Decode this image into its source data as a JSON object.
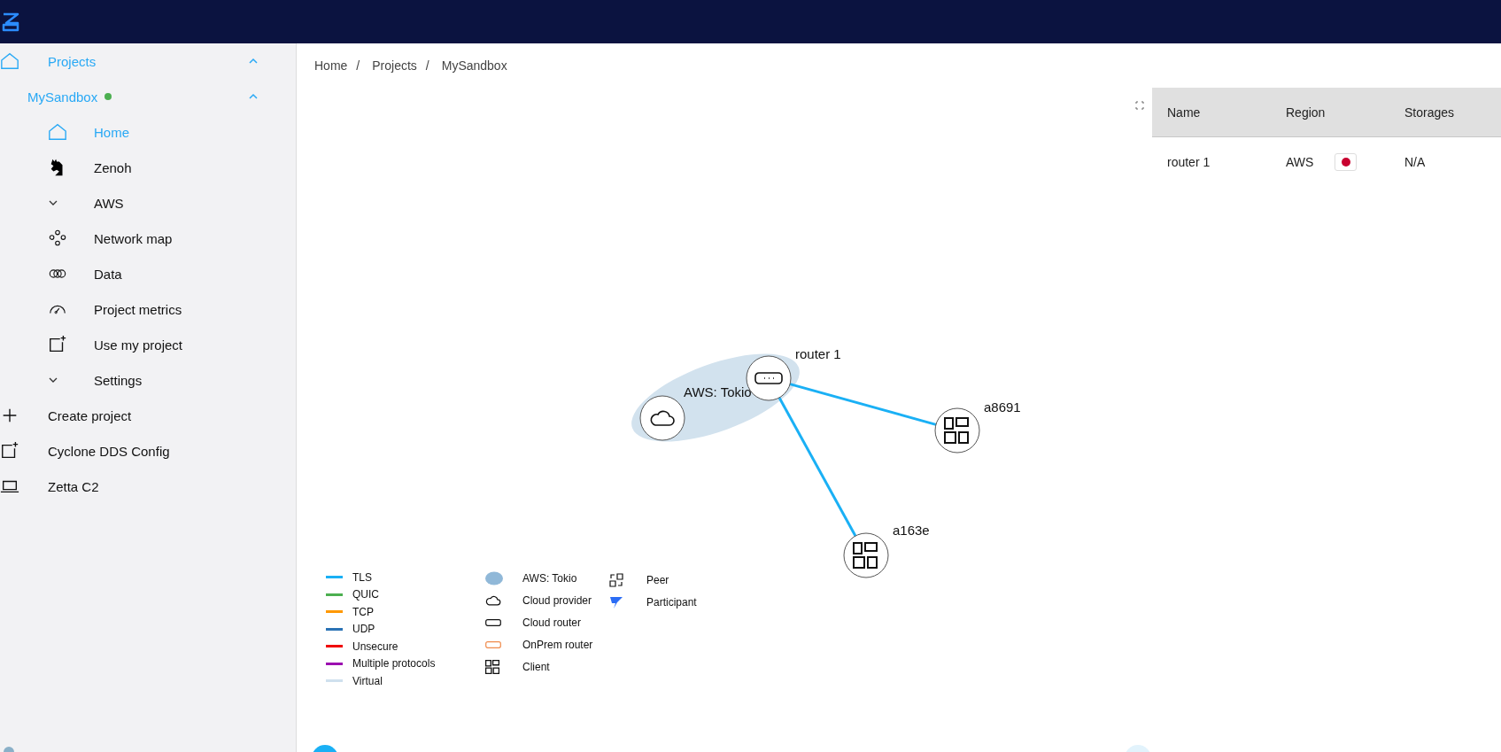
{
  "sidebar": {
    "items": [
      {
        "label": "Projects",
        "kind": "home",
        "selected": true,
        "expanded": true,
        "children": [
          {
            "label": "MySandbox",
            "color": "#4caf50",
            "selected": true,
            "expanded": true,
            "children": [
              {
                "label": "Home",
                "kind": "home",
                "selected": true
              },
              {
                "label": "Zenoh",
                "kind": "dragon",
                "selected": false
              },
              {
                "label": "AWS",
                "kind": "chevron",
                "selected": false
              },
              {
                "label": "Network map",
                "kind": "nodes",
                "selected": false
              },
              {
                "label": "Data",
                "kind": "rings",
                "selected": false
              },
              {
                "label": "Project metrics",
                "kind": "gauge",
                "selected": false
              },
              {
                "label": "Use my project",
                "kind": "addbox",
                "selected": false
              },
              {
                "label": "Settings",
                "kind": "chevron",
                "selected": false
              }
            ]
          }
        ]
      },
      {
        "label": "Create project",
        "kind": "plus",
        "selected": false
      },
      {
        "label": "Cyclone DDS Config",
        "kind": "addbox",
        "selected": false
      },
      {
        "label": "Zetta C2",
        "kind": "laptop",
        "selected": false
      }
    ]
  },
  "breadcrumbs": [
    {
      "label": "Home",
      "separator": "/"
    },
    {
      "label": "Projects",
      "separator": "/"
    },
    {
      "label": "MySandbox"
    }
  ],
  "graph": {
    "region": {
      "label": "AWS: Tokio"
    },
    "nodes": [
      {
        "kind": "cloud"
      },
      {
        "label": "router 1",
        "kind": "router"
      },
      {
        "label": "a8691",
        "kind": "client"
      },
      {
        "label": "a163e",
        "kind": "client"
      }
    ],
    "edges": [
      {
        "color": "#1ab0f5"
      },
      {
        "color": "#1ab0f5"
      }
    ]
  },
  "legend": {
    "protocols": [
      {
        "label": "TLS",
        "color": "#1ab0f5"
      },
      {
        "label": "QUIC",
        "color": "#4caf50"
      },
      {
        "label": "TCP",
        "color": "#ff9800"
      },
      {
        "label": "UDP",
        "color": "#2a72b5"
      },
      {
        "label": "Unsecure",
        "color": "#f00000"
      },
      {
        "label": "Multiple protocols",
        "color": "#9c0fb0"
      },
      {
        "label": "Virtual",
        "color": "#cfe0ee"
      }
    ],
    "symbols": [
      {
        "label": "AWS: Tokio",
        "kind": "region"
      },
      {
        "label": "Cloud provider",
        "kind": "cloud"
      },
      {
        "label": "Cloud router",
        "kind": "router"
      },
      {
        "label": "OnPrem router",
        "kind": "onprem"
      },
      {
        "label": "Client",
        "kind": "client"
      }
    ],
    "roles": [
      {
        "label": "Peer",
        "kind": "peer"
      },
      {
        "label": "Participant",
        "kind": "participant"
      }
    ]
  },
  "table": {
    "columns": [
      "Name",
      "Region",
      "Storages"
    ],
    "rows": [
      {
        "name": "router 1",
        "region": "AWS",
        "storages": "N/A"
      }
    ]
  }
}
